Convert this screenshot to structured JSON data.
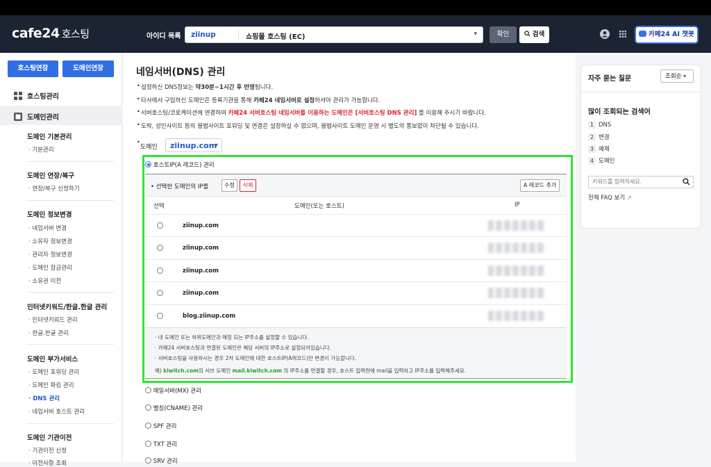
{
  "header": {
    "logo": "cafe24",
    "logo_sub": "호스팅",
    "account_label": "아이디 목록",
    "account_id": "ziinup",
    "account_type": "쇼핑몰 호스팅 (EC)",
    "confirm_label": "확인",
    "search_label": "검색",
    "ai_label": "카페24 AI 챗봇"
  },
  "sidebar": {
    "hosting_extend": "호스팅연장",
    "domain_extend": "도메인연장",
    "hosting_manage": "호스팅관리",
    "domain_manage": "도메인관리",
    "groups": [
      {
        "title": "도메인 기본관리",
        "items": [
          "기본관리"
        ]
      },
      {
        "title": "도메인 연장/복구",
        "items": [
          "연장/복구 신청하기"
        ]
      },
      {
        "title": "도메인 정보변경",
        "items": [
          "네임서버 변경",
          "소유자 정보변경",
          "관리자 정보변경",
          "도메인 잠금관리",
          "소유권 이전"
        ]
      },
      {
        "title": "인터넷키워드/한글.한글 관리",
        "items": [
          "인터넷키워드 관리",
          "한글.한글 관리"
        ]
      },
      {
        "title": "도메인 부가서비스",
        "items": [
          "도메인 포워딩 관리",
          "도메인 파킹 관리",
          "DNS 관리",
          "네임서버 호스트 관리"
        ]
      },
      {
        "title": "도메인 기관이전",
        "items": [
          "기관이전 신청",
          "이전사항 조회"
        ]
      }
    ]
  },
  "main": {
    "title": "네임서버(DNS) 관리",
    "notes": {
      "n1_a": "설정하신 DNS정보는 ",
      "n1_b": "약30분~1시간 후 반영",
      "n1_c": "됩니다.",
      "n2_a": "타사에서 구입하신 도메인은 등록기관을 통해 ",
      "n2_b": "카페24 네임서버로 설정",
      "n2_c": "하셔야 관리가 가능합니다.",
      "n3_a": "서버호스팅/코로케이션에 연결하여 ",
      "n3_b": "카페24 서버호스팅 네임서버를 이용하는 도메인은",
      "n3_c": " [서버호스팅 DNS 관리]",
      "n3_d": " 를 이용해 주시기 바랍니다.",
      "n4": "도박, 성인사이트 등의 불법사이트 포워딩 및 연결은 설정하실 수 없으며, 불법사이트 도메인 운영 시 별도의 통보없이 차단될 수 있습니다."
    },
    "domain_label": "도메인",
    "domain_value": "ziinup.com",
    "record_types": {
      "a": "호스트IP(A 레코드) 관리",
      "mx": "메일서버(MX) 관리",
      "cname": "별칭(CNAME) 관리",
      "spf": "SPF 관리",
      "txt": "TXT 관리",
      "srv": "SRV 관리"
    },
    "toolbar": {
      "label": "선택한 도메인의 IP를",
      "edit": "수정",
      "delete": "삭제",
      "add": "A 레코드 추가"
    },
    "columns": {
      "select": "선택",
      "domain": "도메인(또는 호스트)",
      "ip": "IP"
    },
    "rows": [
      {
        "host": "ziinup.com"
      },
      {
        "host": "ziinup.com"
      },
      {
        "host": "ziinup.com"
      },
      {
        "host": "ziinup.com"
      },
      {
        "host": "blog.ziinup.com"
      }
    ],
    "help": {
      "h1": "· 내 도메인 또는 하위도메인과 매칭 되는 IP주소를 설정할 수 있습니다.",
      "h2": "· 카페24 서버호스팅과 연결된 도메인은 해당 서버의 IP주소로 설정되어있습니다.",
      "h3": "· 서버호스팅을 사용하시는 경우 2차 도메인에 대한 호스트IP(A레코드)만 변경이 가능합니다.",
      "ex_a": "예) ",
      "ex_b": "kiwitch.com",
      "ex_c": "의 서브 도메인 ",
      "ex_d": "mail.kiwitch.com",
      "ex_e": " 의 IP주소를 연결할 경우, 호스트 입력란에 mail을 입력하고 IP주소를 입력해주세요."
    }
  },
  "right": {
    "faq_title": "자주 묻는 질문",
    "sort": "조회순",
    "popular_title": "많이 조회되는 검색어",
    "popular": [
      {
        "n": "1",
        "t": "DNS"
      },
      {
        "n": "2",
        "t": "변경"
      },
      {
        "n": "3",
        "t": "예제"
      },
      {
        "n": "4",
        "t": "도메인"
      }
    ],
    "keyword_placeholder": "키워드를 입력하세요.",
    "faq_link": "전체 FAQ 보기"
  },
  "colors": {
    "accent": "#2f6fe3",
    "highlight_box": "#2ee52e",
    "danger": "#d7262d",
    "header_bg": "#1c2333"
  }
}
